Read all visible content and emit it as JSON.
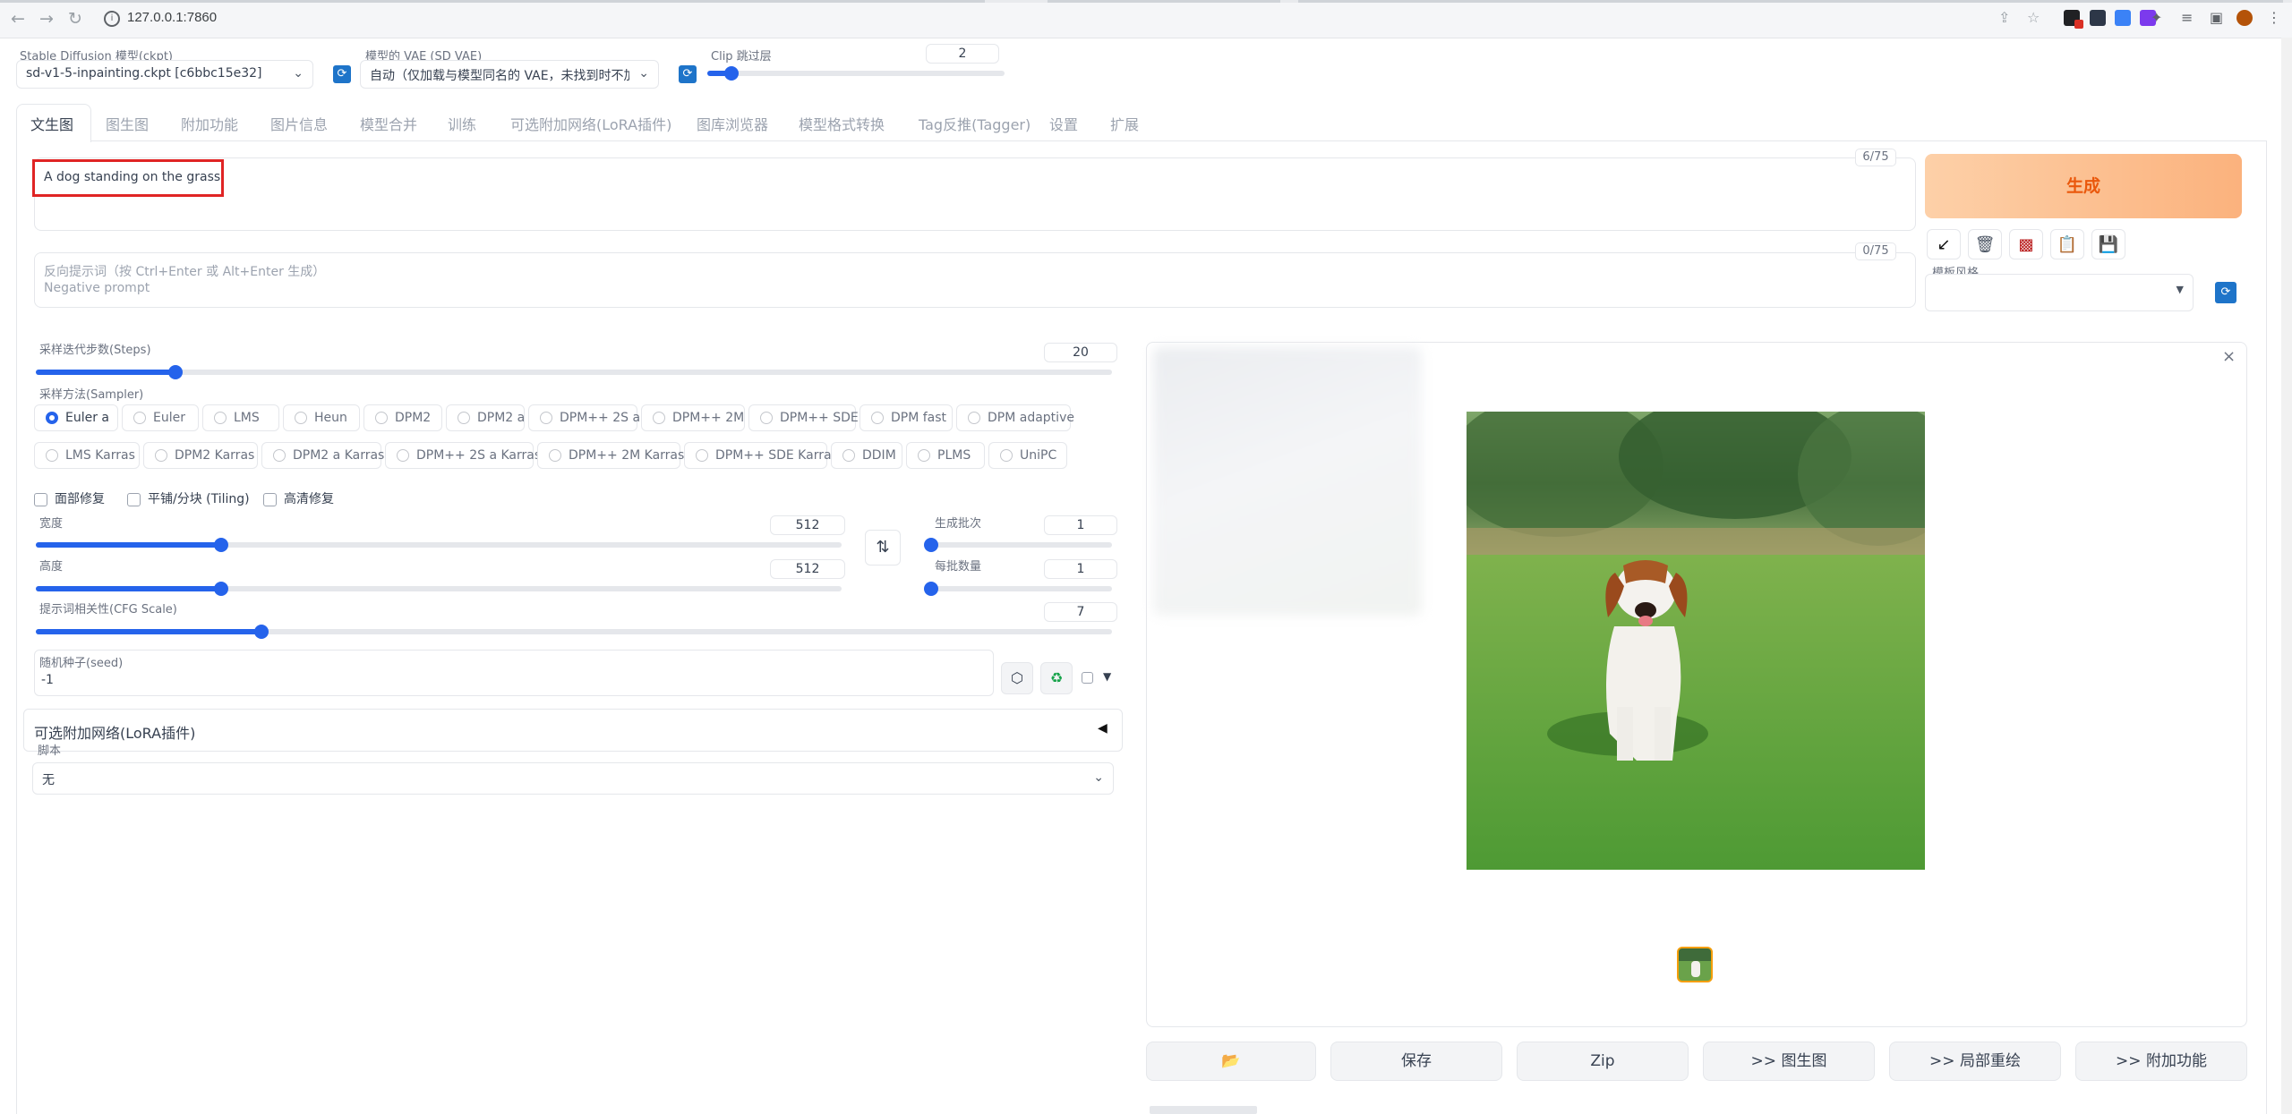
{
  "browser": {
    "url": "127.0.0.1:7860",
    "info_icon": "info-icon"
  },
  "top": {
    "model_label": "Stable Diffusion 模型(ckpt)",
    "model_value": "sd-v1-5-inpainting.ckpt [c6bbc15e32]",
    "vae_label": "模型的 VAE (SD VAE)",
    "vae_value": "自动（仅加载与模型同名的 VAE，未找到时不加载）",
    "clip_label": "Clip 跳过层",
    "clip_value": "2",
    "clip_fraction": 0.08
  },
  "tabs": [
    "文生图",
    "图生图",
    "附加功能",
    "图片信息",
    "模型合并",
    "训练",
    "可选附加网络(LoRA插件)",
    "图库浏览器",
    "模型格式转换",
    "Tag反推(Tagger)",
    "设置",
    "扩展"
  ],
  "prompt": {
    "text": "A dog standing on the grass",
    "counter": "6/75"
  },
  "negative": {
    "placeholder_line1": "反向提示词（按 Ctrl+Enter 或 Alt+Enter 生成）",
    "placeholder_line2": "Negative prompt",
    "counter": "0/75"
  },
  "generate_label": "生成",
  "style_label": "模板风格",
  "steps": {
    "label": "采样迭代步数(Steps)",
    "value": "20",
    "fraction": 0.13
  },
  "sampler": {
    "label": "采样方法(Sampler)",
    "selected": "Euler a",
    "row1": [
      "Euler a",
      "Euler",
      "LMS",
      "Heun",
      "DPM2",
      "DPM2 a",
      "DPM++ 2S a",
      "DPM++ 2M",
      "DPM++ SDE",
      "DPM fast",
      "DPM adaptive"
    ],
    "row2": [
      "LMS Karras",
      "DPM2 Karras",
      "DPM2 a Karras",
      "DPM++ 2S a Karras",
      "DPM++ 2M Karras",
      "DPM++ SDE Karras",
      "DDIM",
      "PLMS",
      "UniPC"
    ]
  },
  "checks": {
    "face": "面部修复",
    "tiling": "平铺/分块 (Tiling)",
    "hires": "高清修复"
  },
  "width": {
    "label": "宽度",
    "value": "512",
    "fraction": 0.23
  },
  "height": {
    "label": "高度",
    "value": "512",
    "fraction": 0.23
  },
  "batch_count": {
    "label": "生成批次",
    "value": "1",
    "fraction": 0.0
  },
  "batch_size": {
    "label": "每批数量",
    "value": "1",
    "fraction": 0.0
  },
  "cfg": {
    "label": "提示词相关性(CFG Scale)",
    "value": "7",
    "fraction": 0.21
  },
  "seed": {
    "label": "随机种子(seed)",
    "value": "-1"
  },
  "lora_section": "可选附加网络(LoRA插件)",
  "script": {
    "label": "脚本",
    "value": "无"
  },
  "output_buttons": {
    "save": "保存",
    "zip": "Zip",
    "to_img2img": ">> 图生图",
    "to_inpaint": ">> 局部重绘",
    "to_extras": ">> 附加功能"
  },
  "colors": {
    "accent": "#2563eb",
    "generate_text": "#ea580c",
    "highlight": "#e02424",
    "refresh": "#1e74c9"
  }
}
